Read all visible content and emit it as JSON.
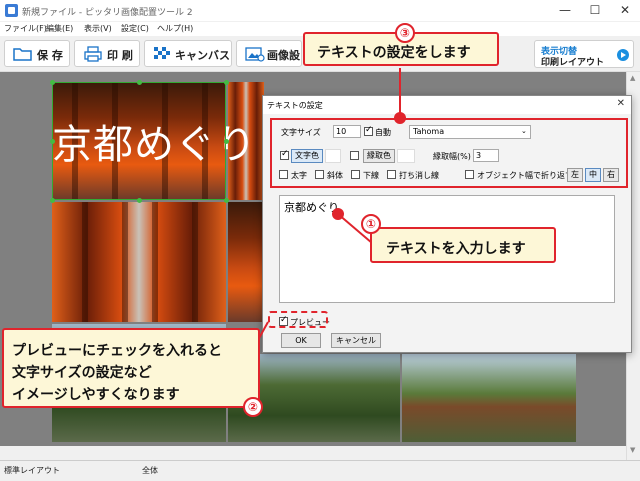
{
  "window": {
    "title": "新規ファイル - ピッタリ画像配置ツール 2",
    "minimize": "—",
    "maximize": "☐",
    "close": "✕"
  },
  "menu": [
    "ファイル(F)",
    "編集(E)",
    "表示(V)",
    "設定(C)",
    "ヘルプ(H)"
  ],
  "toolbar": {
    "save": "保 存",
    "print": "印 刷",
    "canvas": "キャンバス",
    "image": "画像設",
    "switch_line1": "表示切替",
    "switch_line2": "印刷レイアウト"
  },
  "canvas": {
    "overlay_text": "京都めぐり"
  },
  "dialog": {
    "title": "テキストの設定",
    "font_size_label": "文字サイズ",
    "font_size_value": "10",
    "auto_label": "自動",
    "font_name": "Tahoma",
    "text_color_label": "文字色",
    "outline_color_label": "縁取色",
    "outline_width_label": "縁取幅(%)",
    "outline_width_value": "3",
    "bold_label": "太字",
    "italic_label": "斜体",
    "underline_label": "下線",
    "strike_label": "打ち消し線",
    "wrap_label": "オブジェクト幅で折り返す",
    "align": [
      "左",
      "中",
      "右"
    ],
    "text_content": "京都めぐり",
    "preview_label": "プレビュー",
    "ok": "OK",
    "cancel": "キャンセル"
  },
  "annotations": {
    "n1": "①",
    "n2": "②",
    "n3": "③",
    "callout1": "テキストを入力します",
    "callout2_line1": "プレビューにチェックを入れると",
    "callout2_line2": "文字サイズの設定など",
    "callout2_line3": "イメージしやすくなります",
    "callout3": "テキストの設定をします",
    "accent_color": "#e0242c",
    "callout_bg": "#fdf7d7"
  },
  "status": {
    "left": "標準レイアウト",
    "middle": "全体"
  }
}
